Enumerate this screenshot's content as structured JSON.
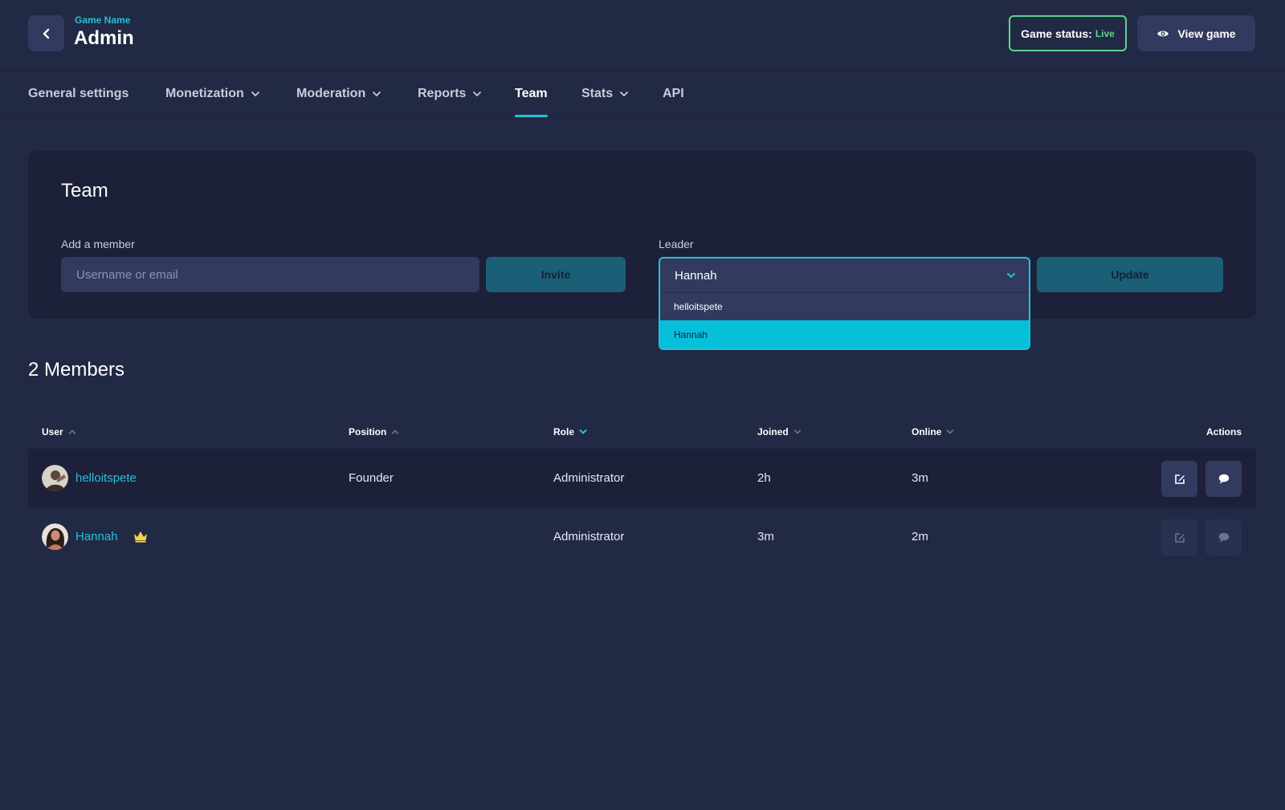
{
  "header": {
    "game_name": "Game Name",
    "title": "Admin",
    "status_label": "Game status:",
    "status_value": "Live",
    "view_label": "View game"
  },
  "nav": {
    "items": [
      {
        "label": "General settings",
        "dropdown": false
      },
      {
        "label": "Monetization",
        "dropdown": true
      },
      {
        "label": "Moderation",
        "dropdown": true
      },
      {
        "label": "Reports",
        "dropdown": true
      },
      {
        "label": "Team",
        "dropdown": false,
        "active": true
      },
      {
        "label": "Stats",
        "dropdown": true
      },
      {
        "label": "API",
        "dropdown": false
      }
    ]
  },
  "team": {
    "title": "Team",
    "add_label": "Add a member",
    "add_placeholder": "Username or email",
    "invite_label": "Invite",
    "leader_label": "Leader",
    "leader_selected": "Hannah",
    "leader_options": [
      "helloitspete",
      "Hannah"
    ],
    "update_label": "Update"
  },
  "members": {
    "title": "2 Members",
    "columns": {
      "user": "User",
      "position": "Position",
      "role": "Role",
      "joined": "Joined",
      "online": "Online",
      "actions": "Actions"
    },
    "rows": [
      {
        "user": "helloitspete",
        "position": "Founder",
        "role": "Administrator",
        "joined": "2h",
        "online": "3m",
        "leader": false
      },
      {
        "user": "Hannah",
        "position": "",
        "role": "Administrator",
        "joined": "3m",
        "online": "2m",
        "leader": true
      }
    ]
  },
  "colors": {
    "accent": "#1fc3d8",
    "live": "#5fd28f",
    "crown": "#f5d547"
  }
}
